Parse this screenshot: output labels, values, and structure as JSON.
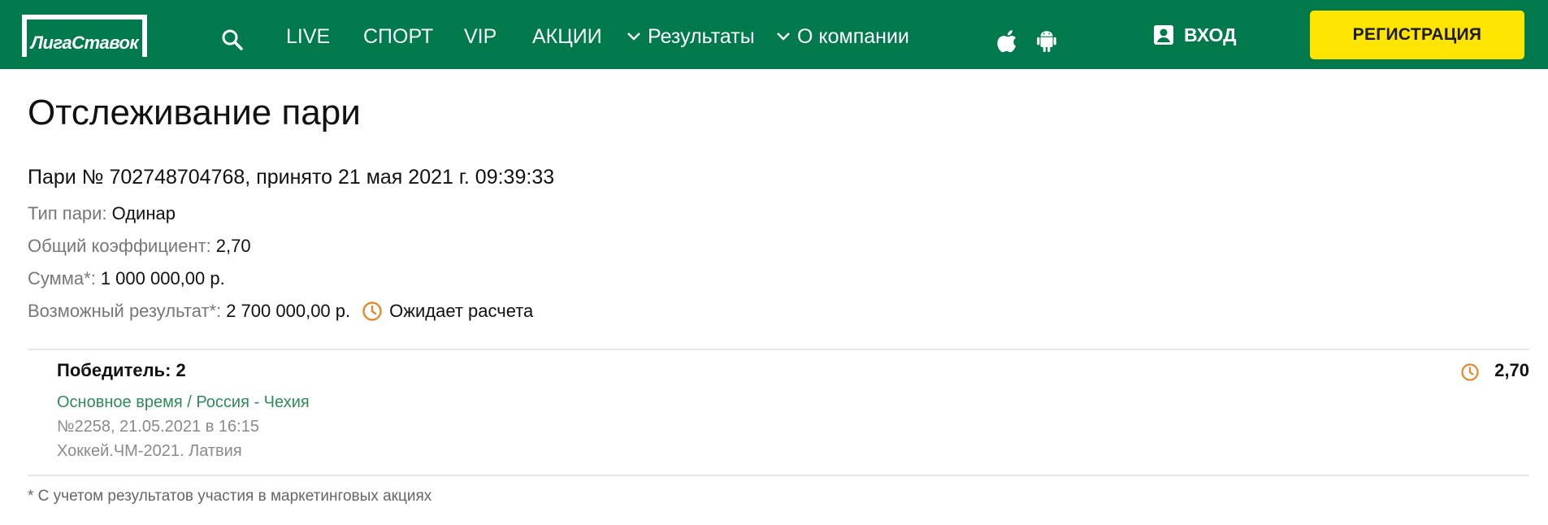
{
  "header": {
    "logo_text": "ЛигаСтавок",
    "nav": {
      "live": "LIVE",
      "sport": "СПОРТ",
      "vip": "VIP",
      "promos": "АКЦИИ",
      "results": "Результаты",
      "about": "О компании"
    },
    "login_label": "ВХОД",
    "register_label": "РЕГИСТРАЦИЯ",
    "icons": [
      "search-icon",
      "apple-icon",
      "android-icon",
      "user-icon",
      "chevron-down-icon"
    ],
    "colors": {
      "brand_green": "#007a4d",
      "accent_yellow": "#ffe400"
    }
  },
  "main": {
    "title": "Отслеживание пари",
    "bet_header": "Пари № 702748704768, принято 21 мая 2021 г. 09:39:33",
    "bet_type": {
      "label": "Тип пари:",
      "value": "Одинар"
    },
    "total_odds": {
      "label": "Общий коэффициент:",
      "value": "2,70"
    },
    "stake": {
      "label": "Сумма*:",
      "value": "1 000 000,00 р."
    },
    "possible_result": {
      "label": "Возможный результат*:",
      "value": "2 700 000,00 р."
    },
    "status": "Ожидает расчета",
    "selection": {
      "outcome": "Победитель: 2",
      "event": "Основное время / Россия - Чехия",
      "event_info": "№2258, 21.05.2021 в 16:15",
      "league": "Хоккей.ЧМ-2021. Латвия",
      "odds": "2,70",
      "status_icon": "clock-icon"
    },
    "footnote": "* С учетом результатов участия в маркетинговых акциях",
    "colors": {
      "pending_orange": "#e08a2e",
      "link_green": "#2e8b57"
    }
  }
}
